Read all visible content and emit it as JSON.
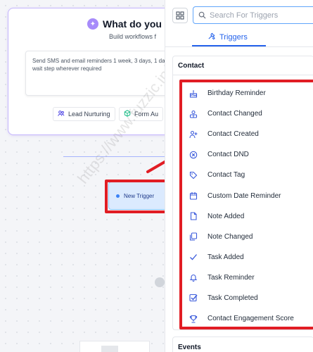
{
  "canvas": {
    "ai_card": {
      "title": "What do you",
      "subtitle": "Build workflows f",
      "prompt_text": "Send SMS and email reminders 1 week, 3 days, 1 da wait step wherever required",
      "chips": [
        {
          "label": "Lead Nurturing",
          "icon": "people-icon"
        },
        {
          "label": "Form Au",
          "icon": "cube-icon"
        }
      ]
    },
    "trigger_node": {
      "label": "New Trigger"
    },
    "watermark": "https://www.fuzzic.in/"
  },
  "panel": {
    "search": {
      "placeholder": "Search For Triggers",
      "value": ""
    },
    "tab": {
      "label": "Triggers",
      "icon": "wrench-icon"
    },
    "section": {
      "title": "Contact",
      "items": [
        {
          "label": "Birthday Reminder",
          "icon": "cake-icon"
        },
        {
          "label": "Contact Changed",
          "icon": "contacts-icon"
        },
        {
          "label": "Contact Created",
          "icon": "user-plus-icon"
        },
        {
          "label": "Contact DND",
          "icon": "dnd-icon"
        },
        {
          "label": "Contact Tag",
          "icon": "tag-icon"
        },
        {
          "label": "Custom Date Reminder",
          "icon": "calendar-icon"
        },
        {
          "label": "Note Added",
          "icon": "note-icon"
        },
        {
          "label": "Note Changed",
          "icon": "notes-icon"
        },
        {
          "label": "Task Added",
          "icon": "check-icon"
        },
        {
          "label": "Task Reminder",
          "icon": "bell-icon"
        },
        {
          "label": "Task Completed",
          "icon": "checkbox-icon"
        },
        {
          "label": "Contact Engagement Score",
          "icon": "trophy-icon"
        }
      ]
    },
    "events": {
      "title": "Events"
    }
  },
  "colors": {
    "accent": "#2563eb",
    "highlight": "#e11d24",
    "ai_border": "#c4b5fd",
    "node_bg": "#dbeafe"
  }
}
